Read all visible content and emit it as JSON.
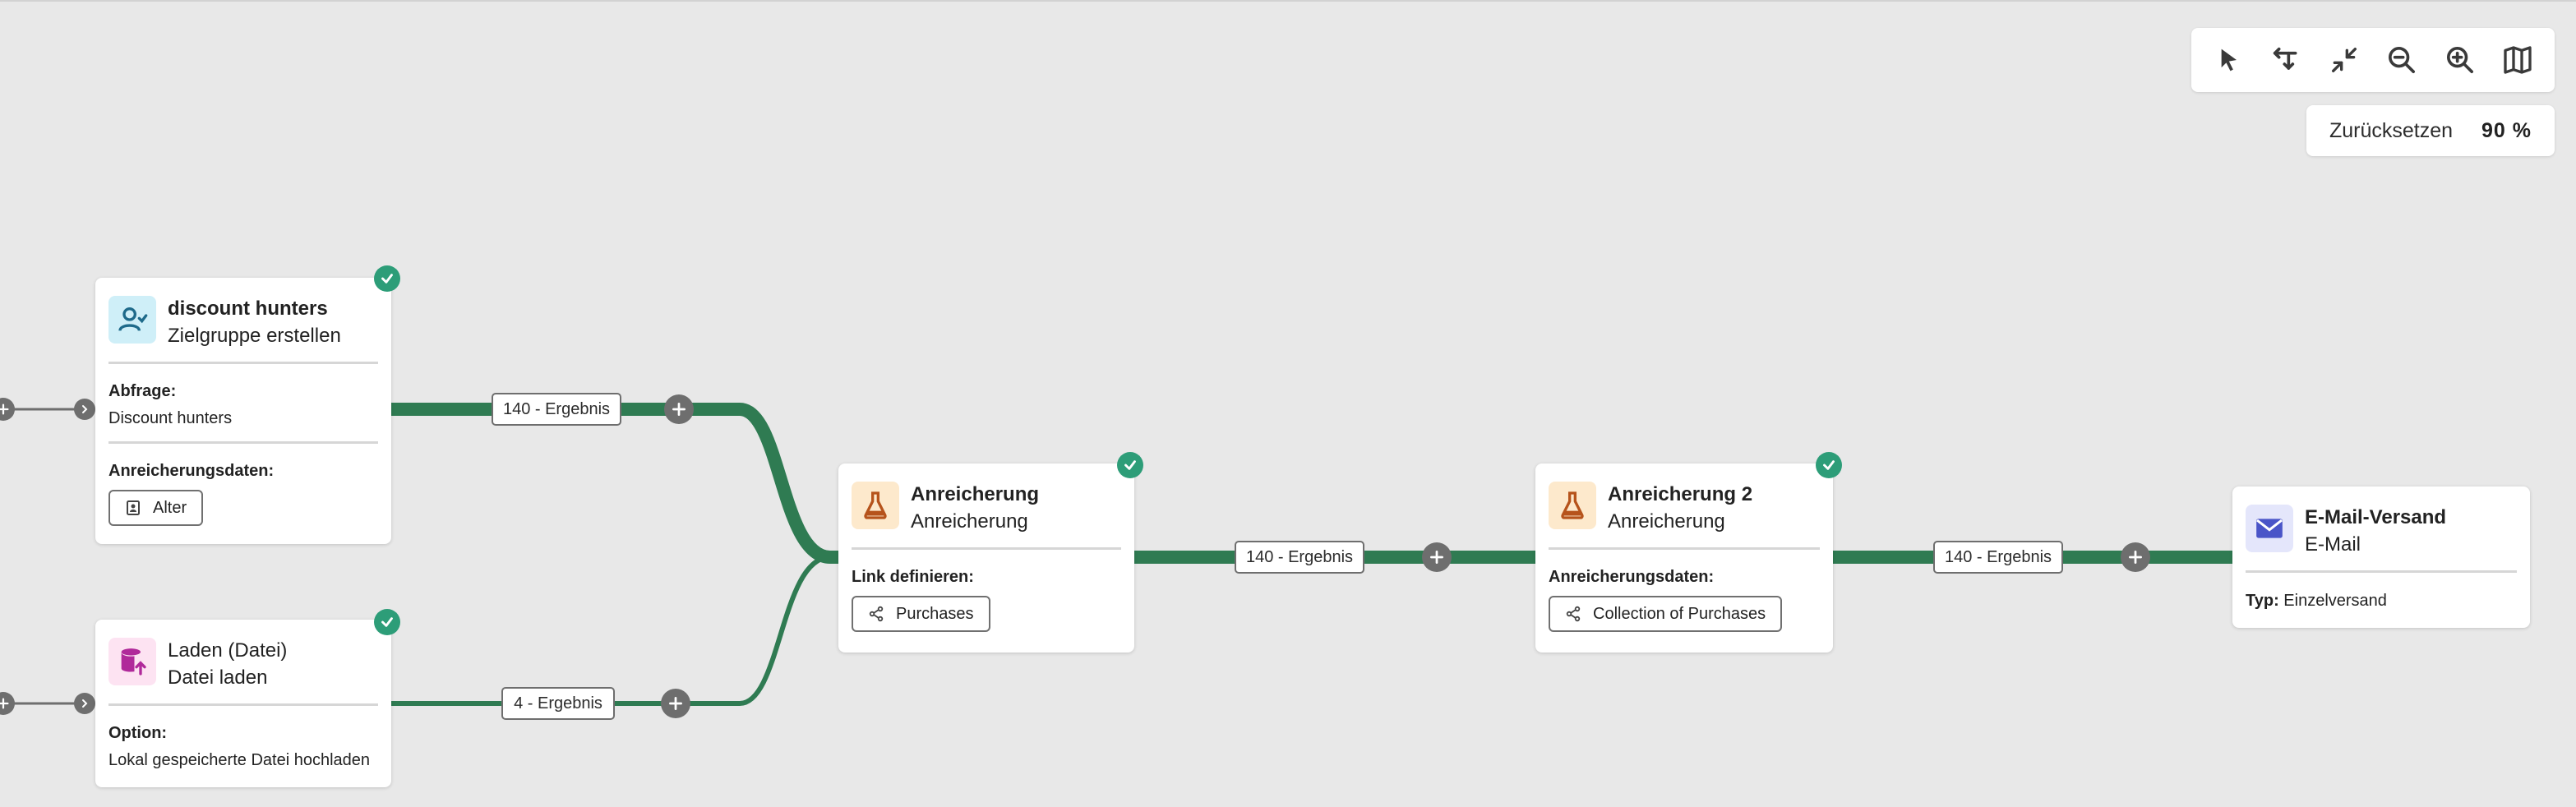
{
  "toolbar": {
    "icons": [
      "pointer-icon",
      "rearrange-icon",
      "collapse-icon",
      "zoom-out-icon",
      "zoom-in-icon",
      "map-icon"
    ],
    "reset_label": "Zurücksetzen",
    "zoom_level": "90 %"
  },
  "colors": {
    "link": "#2f7b52",
    "success": "#2d9d78",
    "audience_icon_bg": "#cfeff8",
    "file_icon_bg": "#fde3f2",
    "enrich_icon_bg": "#fde9cc",
    "email_icon_bg": "#e4e6fb"
  },
  "nodes": {
    "discount": {
      "title": "discount hunters",
      "subtitle": "Zielgruppe erstellen",
      "query_label": "Abfrage:",
      "query_value": "Discount hunters",
      "enrich_label": "Anreicherungsdaten:",
      "chip": "Alter",
      "icon": "audience-icon"
    },
    "file": {
      "title": "Laden (Datei)",
      "subtitle": "Datei laden",
      "option_label": "Option:",
      "option_value": "Lokal gespeicherte Datei hochladen",
      "icon": "database-upload-icon"
    },
    "enrich1": {
      "title": "Anreicherung",
      "subtitle": "Anreicherung",
      "link_label": "Link definieren:",
      "chip": "Purchases",
      "icon": "flask-icon"
    },
    "enrich2": {
      "title": "Anreicherung 2",
      "subtitle": "Anreicherung",
      "enrich_label": "Anreicherungsdaten:",
      "chip": "Collection of Purchases",
      "icon": "flask-icon"
    },
    "email": {
      "title": "E-Mail-Versand",
      "subtitle": "E-Mail",
      "type_label": "Typ:",
      "type_value": "Einzelversand",
      "icon": "envelope-icon"
    }
  },
  "links": {
    "discount_out": "140 - Ergebnis",
    "file_out": "4 - Ergebnis",
    "enrich1_out": "140 - Ergebnis",
    "enrich2_out": "140 - Ergebnis"
  }
}
